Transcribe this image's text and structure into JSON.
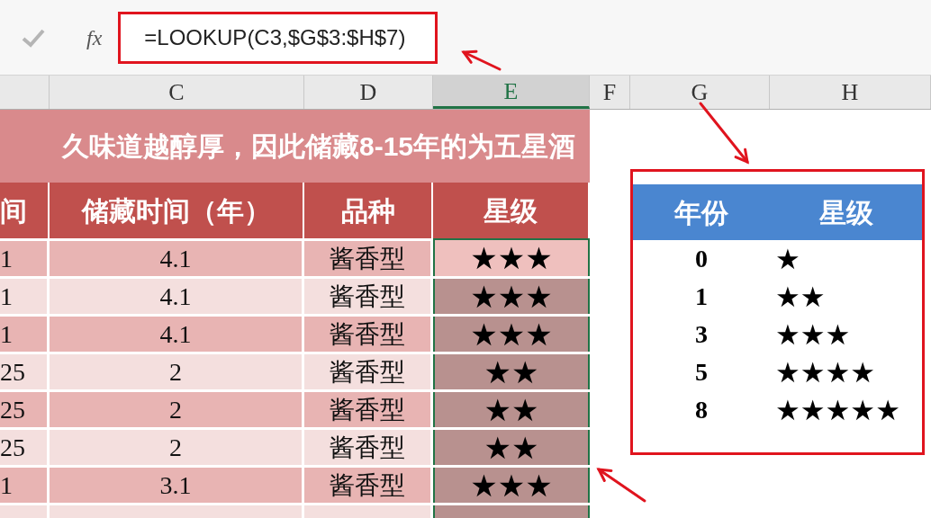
{
  "formula_bar": {
    "fx": "fx",
    "formula": "=LOOKUP(C3,$G$3:$H$7)"
  },
  "column_headers": [
    {
      "label": "C",
      "selected": false
    },
    {
      "label": "D",
      "selected": false
    },
    {
      "label": "E",
      "selected": true
    },
    {
      "label": "F",
      "selected": false
    },
    {
      "label": "G",
      "selected": false
    },
    {
      "label": "H",
      "selected": false
    }
  ],
  "title_banner": "久味道越醇厚，因此储藏8-15年的为五星酒",
  "table": {
    "columns": [
      "间",
      "储藏时间（年）",
      "品种",
      "星级"
    ],
    "rows": [
      {
        "cells": [
          "1",
          "4.1",
          "酱香型",
          "★★★"
        ],
        "active": true
      },
      {
        "cells": [
          "1",
          "4.1",
          "酱香型",
          "★★★"
        ],
        "active": false
      },
      {
        "cells": [
          "1",
          "4.1",
          "酱香型",
          "★★★"
        ],
        "active": false
      },
      {
        "cells": [
          "25",
          "2",
          "酱香型",
          "★★"
        ],
        "active": false
      },
      {
        "cells": [
          "25",
          "2",
          "酱香型",
          "★★"
        ],
        "active": false
      },
      {
        "cells": [
          "25",
          "2",
          "酱香型",
          "★★"
        ],
        "active": false
      },
      {
        "cells": [
          "1",
          "3.1",
          "酱香型",
          "★★★"
        ],
        "active": false
      }
    ]
  },
  "lookup_table": {
    "columns": [
      "年份",
      "星级"
    ],
    "rows": [
      [
        "0",
        "★"
      ],
      [
        "1",
        "★★"
      ],
      [
        "3",
        "★★★"
      ],
      [
        "5",
        "★★★★"
      ],
      [
        "8",
        "★★★★★"
      ]
    ]
  }
}
